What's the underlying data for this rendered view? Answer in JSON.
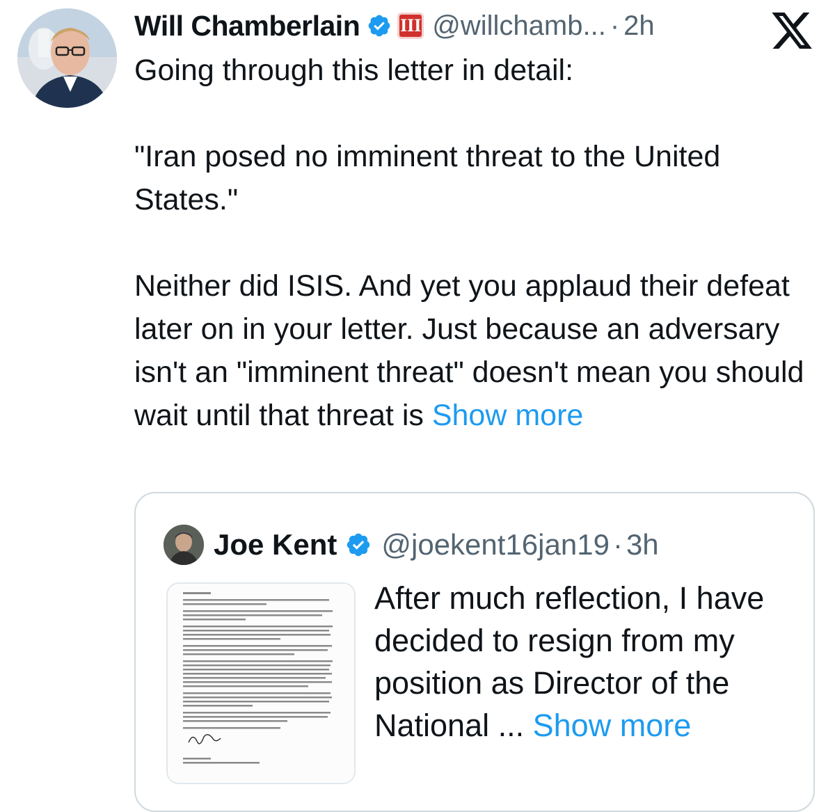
{
  "tweet": {
    "author_name": "Will Chamberlain",
    "handle": "@willchamb...",
    "separator": "·",
    "time": "2h",
    "affiliation_badge_glyph": "III",
    "text_line_1": "Going through this letter in detail:",
    "text_quote": "\"Iran posed no imminent threat to the United States.\"",
    "text_paragraph_main": "Neither did ISIS. And yet you applaud their defeat later on in your letter. Just because an adversary isn't an \"imminent threat\" doesn't mean you should wait until that threat is",
    "show_more_label": "Show more"
  },
  "quoted_tweet": {
    "author_name": "Joe Kent",
    "handle": "@joekent16jan19",
    "separator": "·",
    "time": "3h",
    "text": "After much reflection, I have decided to resign from my position as Director of the National ...",
    "show_more_label": "Show more"
  },
  "icons": {
    "verified": "verified-badge-icon",
    "affiliation": "affiliation-badge-icon",
    "platform": "x-logo-icon"
  },
  "colors": {
    "link": "#1d9bf0",
    "secondary_text": "#536471",
    "primary_text": "#0f1419",
    "verified_blue": "#1d9bf0",
    "affiliation_red": "#d0312d",
    "card_border": "#cfd9de"
  }
}
